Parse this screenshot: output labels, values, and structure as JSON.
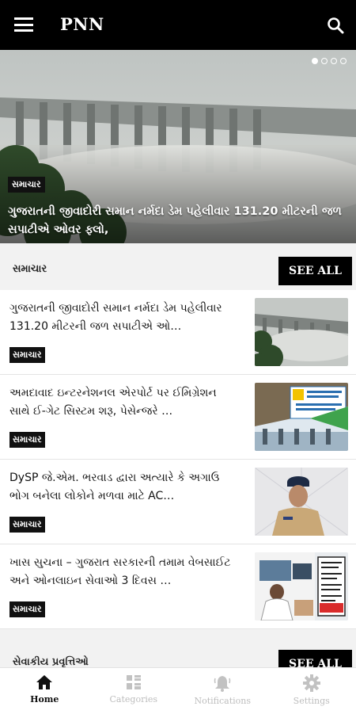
{
  "app": {
    "title": "PNN"
  },
  "hero": {
    "badge": "સમાચાર",
    "headline": "ગુજરાતની જીવાદોરી સમાન નર્મદા ડેમ પહેલીવાર 131.20 મીટરની જળ સપાટીએ ઓવર ફ્લો,",
    "slides": 4,
    "active_slide": 1
  },
  "section": {
    "label": "સમાચાર",
    "see_all": "SEE ALL"
  },
  "articles": [
    {
      "text": "ગુજરાતની જીવાદોરી સમાન નર્મદા ડેમ પહેલીવાર 131.20 મીટરની જળ સપાટીએ ઓ…",
      "category": "સમાચાર"
    },
    {
      "text": "અમદાવાદ ઇન્ટરનેશનલ એરપોર્ટ પર ઈમિગ્રેશન સાથે ઈ-ગેટ સિસ્ટમ શરૂ, પેસેન્જરે …",
      "category": "સમાચાર"
    },
    {
      "text": "DySP જે.એમ. ભરવાડ દ્વારા અત્યારે કે અગાઉ ભોગ બનેલા લોકોને મળવા માટે AC…",
      "category": "સમાચાર"
    },
    {
      "text": "ખાસ સુચના – ગુજરાત સરકારની તમામ વેબસાઈટ અને ઓનલાઇન સેવાઓ 3 દિવસ …",
      "category": "સમાચાર"
    }
  ],
  "section2": {
    "label": "સેવાકીય પ્રવૃત્તિઓ",
    "see_all": "SEE ALL"
  },
  "bottom_nav": [
    {
      "label": "Home",
      "icon": "home-icon",
      "active": true
    },
    {
      "label": "Categories",
      "icon": "grid-icon",
      "active": false
    },
    {
      "label": "Notifications",
      "icon": "bell-icon",
      "active": false
    },
    {
      "label": "Settings",
      "icon": "gear-icon",
      "active": false
    }
  ],
  "colors": {
    "bar": "#000000",
    "background": "#f2f2f2",
    "inactive": "#bdbdbd"
  }
}
